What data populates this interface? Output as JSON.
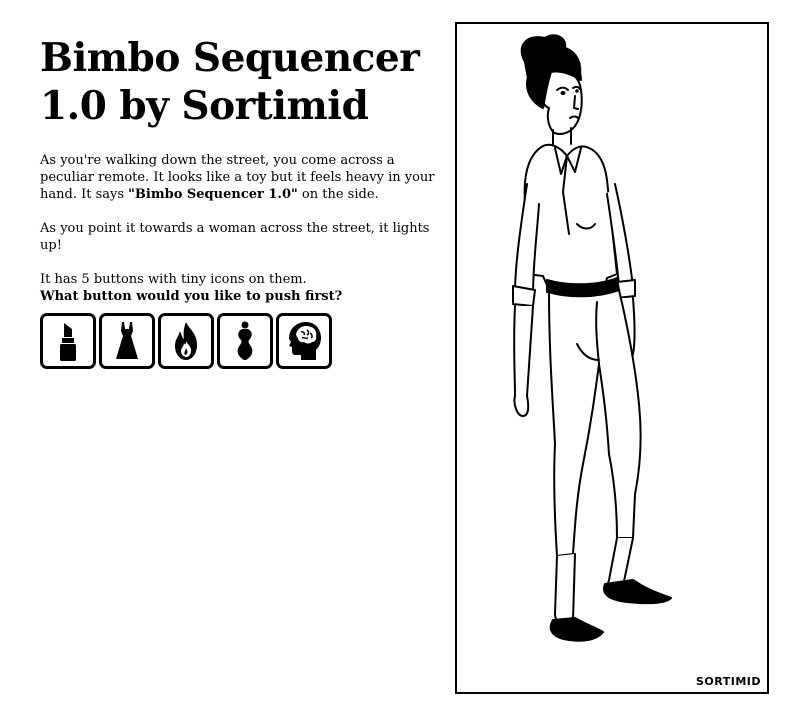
{
  "title": {
    "line1": "Bimbo Sequencer",
    "line2": "1.0 by Sortimid"
  },
  "story": {
    "p1_before": "As you're walking down the street, you come across a peculiar remote. It looks like a toy but it feels heavy in your hand. It says ",
    "p1_bold": "\"Bimbo Sequencer 1.0\"",
    "p1_after": " on the side.",
    "p2": "As you point it towards a woman across the street, it lights up!",
    "p3": "It has 5 buttons with tiny icons on them.",
    "question": "What button would you like to push first?"
  },
  "buttons": [
    {
      "icon": "lipstick-icon"
    },
    {
      "icon": "dress-icon"
    },
    {
      "icon": "fire-icon"
    },
    {
      "icon": "body-shape-icon"
    },
    {
      "icon": "head-brain-icon"
    }
  ],
  "panel": {
    "signature": "SORTIMID"
  }
}
